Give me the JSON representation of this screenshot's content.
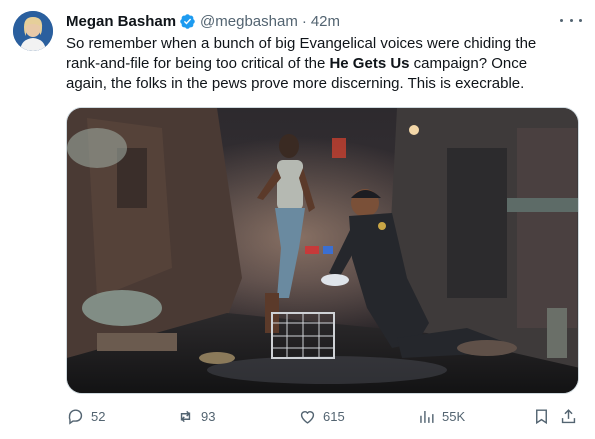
{
  "author": {
    "name": "Megan Basham",
    "handle": "@megbasham",
    "separator": "·",
    "time": "42m"
  },
  "tweet": {
    "text_before": "So remember when a bunch of big Evangelical voices were chiding the rank-and-file for being too critical of the ",
    "text_bold": "He Gets Us",
    "text_after": " campaign? Once again, the folks in the pews prove more discerning. This is execrable."
  },
  "media": {
    "description_icon": "photo"
  },
  "actions": {
    "replies": "52",
    "reposts": "93",
    "likes": "615",
    "views": "55K"
  },
  "colors": {
    "verified": "#1d9bf0",
    "secondary_text": "#536471",
    "primary_text": "#0f1419"
  }
}
